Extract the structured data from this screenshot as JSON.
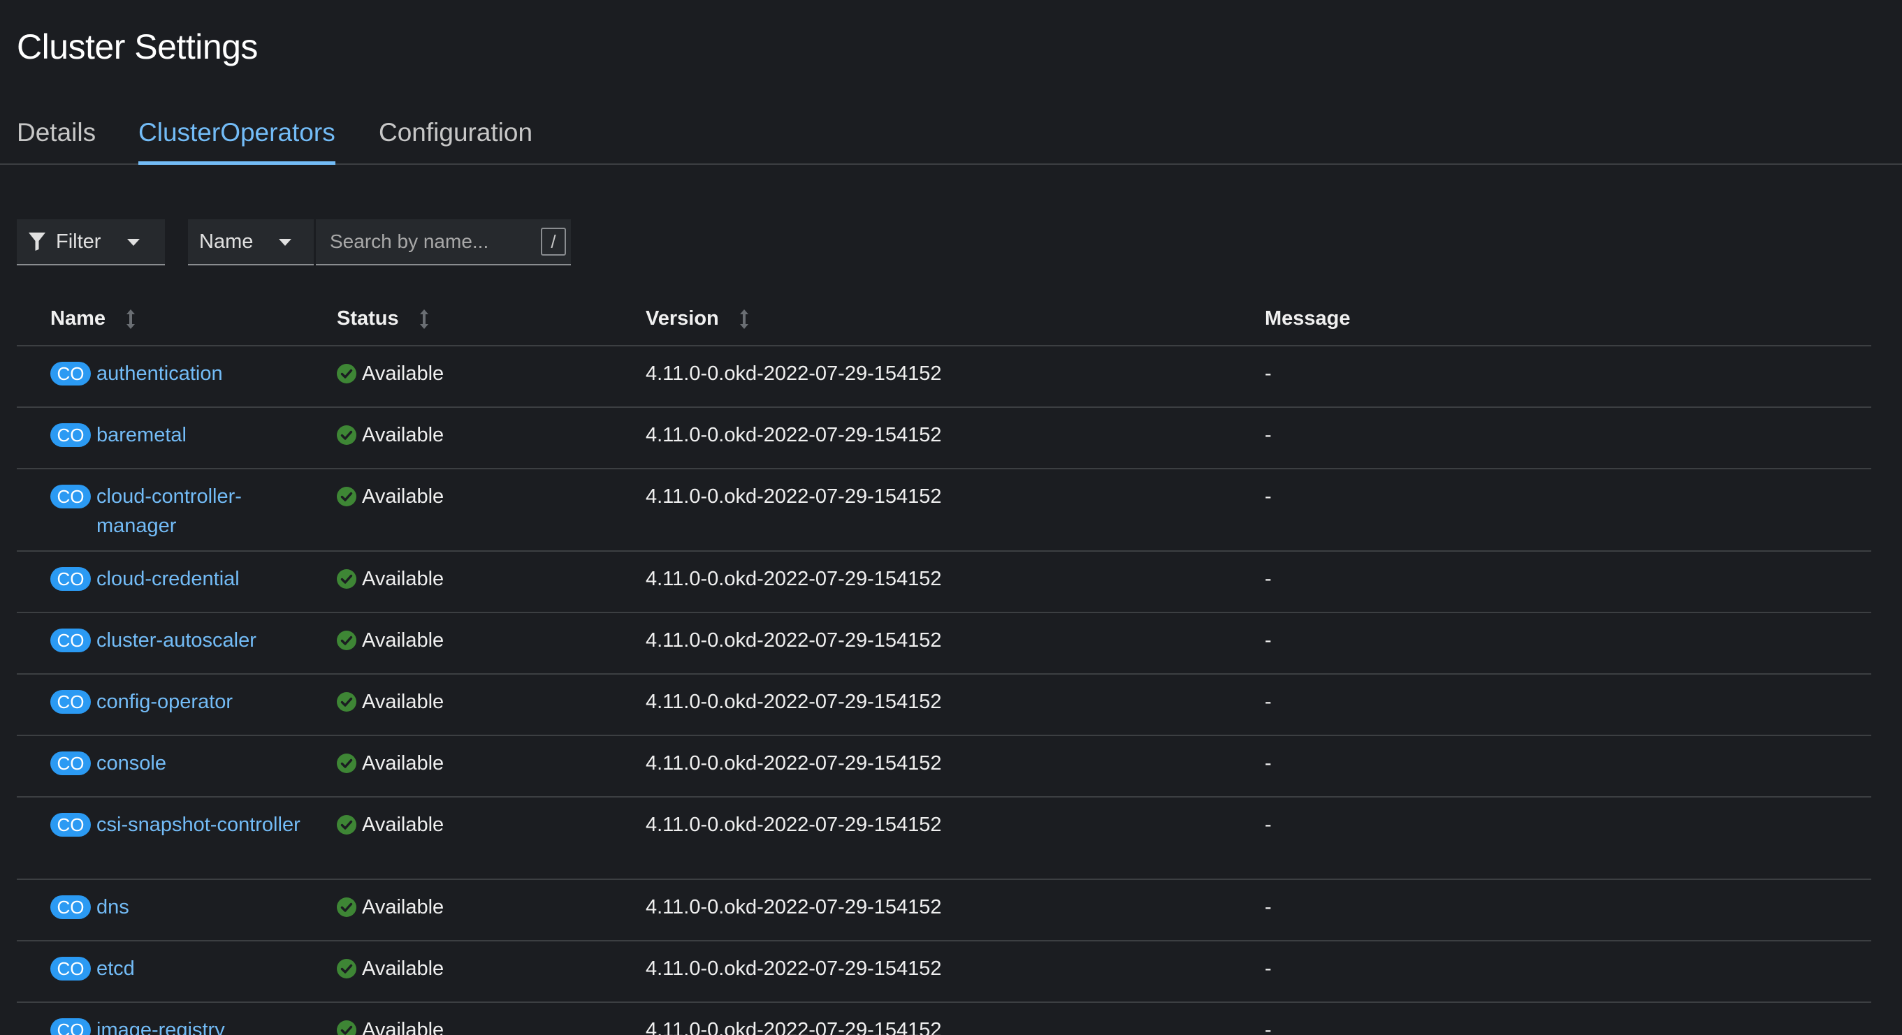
{
  "page": {
    "title": "Cluster Settings"
  },
  "tabs": [
    {
      "label": "Details",
      "active": false
    },
    {
      "label": "ClusterOperators",
      "active": true
    },
    {
      "label": "Configuration",
      "active": false
    }
  ],
  "toolbar": {
    "filter_label": "Filter",
    "filter_icon": "funnel-icon",
    "name_select_value": "Name",
    "search_placeholder": "Search by name...",
    "search_value": "",
    "shortcut_key": "/"
  },
  "table": {
    "columns": [
      {
        "label": "Name",
        "sortable": true
      },
      {
        "label": "Status",
        "sortable": true
      },
      {
        "label": "Version",
        "sortable": true
      },
      {
        "label": "Message",
        "sortable": false
      }
    ],
    "badge": "CO",
    "rows": [
      {
        "name": "authentication",
        "status": "Available",
        "version": "4.11.0-0.okd-2022-07-29-154152",
        "message": "-"
      },
      {
        "name": "baremetal",
        "status": "Available",
        "version": "4.11.0-0.okd-2022-07-29-154152",
        "message": "-"
      },
      {
        "name": "cloud-controller-manager",
        "status": "Available",
        "version": "4.11.0-0.okd-2022-07-29-154152",
        "message": "-"
      },
      {
        "name": "cloud-credential",
        "status": "Available",
        "version": "4.11.0-0.okd-2022-07-29-154152",
        "message": "-"
      },
      {
        "name": "cluster-autoscaler",
        "status": "Available",
        "version": "4.11.0-0.okd-2022-07-29-154152",
        "message": "-"
      },
      {
        "name": "config-operator",
        "status": "Available",
        "version": "4.11.0-0.okd-2022-07-29-154152",
        "message": "-"
      },
      {
        "name": "console",
        "status": "Available",
        "version": "4.11.0-0.okd-2022-07-29-154152",
        "message": "-"
      },
      {
        "name": "csi-snapshot-controller",
        "status": "Available",
        "version": "4.11.0-0.okd-2022-07-29-154152",
        "message": "-"
      },
      {
        "name": "dns",
        "status": "Available",
        "version": "4.11.0-0.okd-2022-07-29-154152",
        "message": "-"
      },
      {
        "name": "etcd",
        "status": "Available",
        "version": "4.11.0-0.okd-2022-07-29-154152",
        "message": "-"
      },
      {
        "name": "image-registry",
        "status": "Available",
        "version": "4.11.0-0.okd-2022-07-29-154152",
        "message": "-"
      }
    ]
  },
  "colors": {
    "background": "#1b1d21",
    "link": "#73bcf7",
    "badge": "#2b9af3",
    "status_ok": "#3e8635",
    "divider": "#3c3f42"
  }
}
